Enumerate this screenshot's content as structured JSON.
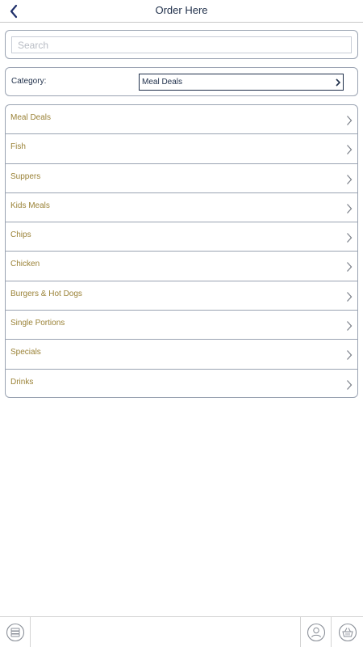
{
  "header": {
    "title": "Order Here"
  },
  "search": {
    "placeholder": "Search",
    "value": ""
  },
  "category": {
    "label": "Category:",
    "selected": "Meal Deals"
  },
  "menu": {
    "items": [
      {
        "label": "Meal Deals"
      },
      {
        "label": "Fish"
      },
      {
        "label": "Suppers"
      },
      {
        "label": "Kids Meals"
      },
      {
        "label": "Chips"
      },
      {
        "label": "Chicken"
      },
      {
        "label": "Burgers & Hot Dogs"
      },
      {
        "label": "Single Portions"
      },
      {
        "label": "Specials"
      },
      {
        "label": "Drinks"
      }
    ]
  },
  "colors": {
    "accent_text": "#9a8237",
    "primary": "#1f2f4a",
    "border": "#9aa3b2"
  },
  "icons": {
    "back": "chevron-left-icon",
    "item": "chevron-right-icon",
    "menu": "menu-list-icon",
    "account": "user-icon",
    "basket": "basket-icon"
  }
}
